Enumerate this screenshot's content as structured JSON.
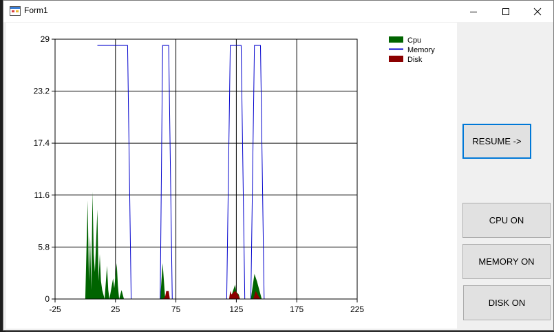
{
  "window": {
    "title": "Form1"
  },
  "buttons": {
    "resume": "RESUME ->",
    "cpu": "CPU ON",
    "memory": "MEMORY ON",
    "disk": "DISK ON"
  },
  "chart_data": {
    "type": "area",
    "x_ticks": [
      "-25",
      "25",
      "75",
      "125",
      "175",
      "225"
    ],
    "y_ticks": [
      "0",
      "5.8",
      "11.6",
      "17.4",
      "23.2",
      "29"
    ],
    "xlim": [
      -25,
      225
    ],
    "ylim": [
      0,
      29
    ],
    "grid": true,
    "legend_position": "top-right",
    "colors": {
      "cpu": "#006400",
      "memory": "#0000cd",
      "disk": "#8b0000"
    },
    "series": [
      {
        "name": "Cpu",
        "style": "area",
        "points": [
          [
            0,
            0
          ],
          [
            2,
            11
          ],
          [
            3,
            2
          ],
          [
            4,
            7
          ],
          [
            5,
            1
          ],
          [
            6,
            12
          ],
          [
            7,
            5
          ],
          [
            8,
            3
          ],
          [
            10,
            10
          ],
          [
            11,
            2
          ],
          [
            12,
            5
          ],
          [
            13,
            2
          ],
          [
            14,
            1
          ],
          [
            16,
            0
          ],
          [
            18,
            3.7
          ],
          [
            19,
            1
          ],
          [
            20,
            0
          ],
          [
            23,
            2.3
          ],
          [
            24,
            1.2
          ],
          [
            26,
            4
          ],
          [
            27,
            1.5
          ],
          [
            28,
            0
          ],
          [
            30,
            1
          ],
          [
            32,
            0
          ],
          [
            35,
            0
          ],
          [
            62,
            0
          ],
          [
            64,
            4
          ],
          [
            66,
            0.3
          ],
          [
            68,
            0
          ],
          [
            120,
            0
          ],
          [
            122,
            0.8
          ],
          [
            124,
            1.6
          ],
          [
            125,
            0.8
          ],
          [
            127,
            0.5
          ],
          [
            128,
            0
          ],
          [
            137,
            0
          ],
          [
            140,
            2.8
          ],
          [
            142,
            2
          ],
          [
            146,
            0
          ],
          [
            225,
            0
          ]
        ]
      },
      {
        "name": "Memory",
        "style": "line",
        "points": [
          [
            10,
            28.3
          ],
          [
            35,
            28.3
          ],
          [
            38,
            0
          ],
          [
            62,
            0
          ],
          [
            64,
            28.3
          ],
          [
            69,
            28.3
          ],
          [
            72,
            0
          ],
          [
            117,
            0
          ],
          [
            120,
            28.3
          ],
          [
            129,
            28.3
          ],
          [
            132,
            0
          ],
          [
            137,
            0
          ],
          [
            140,
            28.3
          ],
          [
            145,
            28.3
          ],
          [
            148,
            0
          ],
          [
            225,
            0
          ]
        ]
      },
      {
        "name": "Disk",
        "style": "area",
        "points": [
          [
            64,
            0
          ],
          [
            66,
            0.2
          ],
          [
            67,
            0.9
          ],
          [
            69,
            0.9
          ],
          [
            70,
            0
          ],
          [
            119,
            0
          ],
          [
            120,
            0.9
          ],
          [
            121,
            0.5
          ],
          [
            124,
            0.9
          ],
          [
            126,
            0.6
          ],
          [
            128,
            0
          ],
          [
            139,
            0
          ],
          [
            141,
            0.9
          ],
          [
            143,
            0.4
          ],
          [
            145,
            0
          ],
          [
            225,
            0
          ]
        ]
      }
    ]
  }
}
